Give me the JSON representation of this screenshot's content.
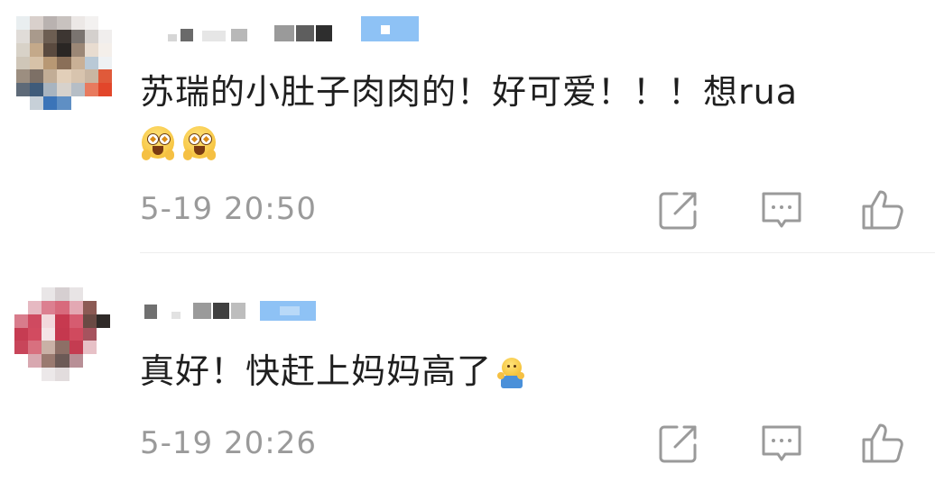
{
  "comments": [
    {
      "text": "苏瑞的小肚子肉肉的！好可爱！！！想rua",
      "emojis": [
        "star-eyes-emoji",
        "star-eyes-emoji"
      ],
      "timestamp": "5-19 20:50"
    },
    {
      "text": "真好！快赶上妈妈高了",
      "emojis": [
        "hug-emoji"
      ],
      "timestamp": "5-19 20:26"
    }
  ],
  "actions": [
    "share-icon",
    "comment-icon",
    "like-icon"
  ],
  "colors": {
    "text": "#1f1f1f",
    "meta": "#9a9a9a",
    "icon": "#9a9a9a",
    "badge": "#8ec2f5",
    "divider": "#eeeeee"
  }
}
